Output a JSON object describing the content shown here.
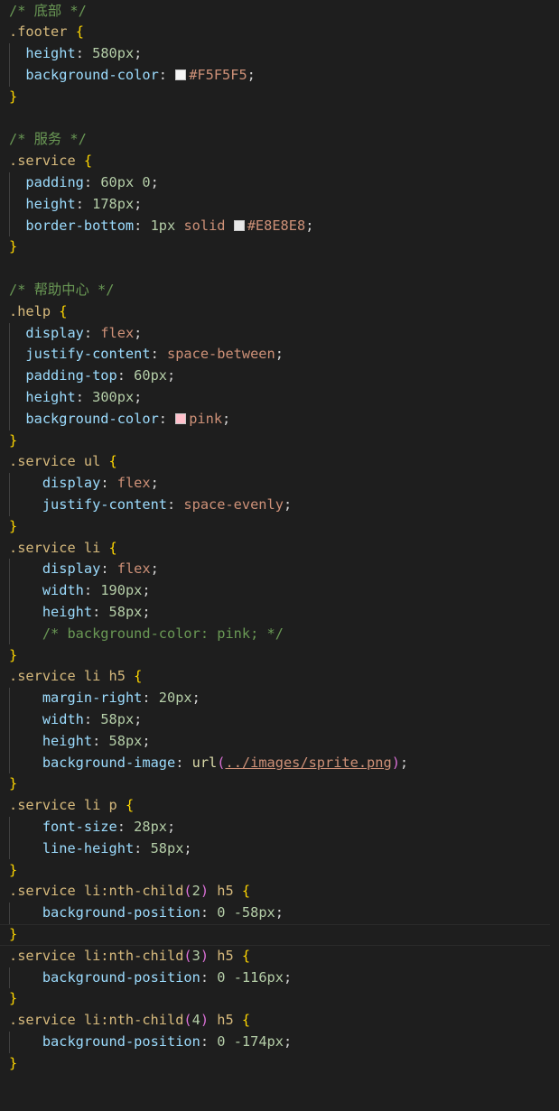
{
  "editor": {
    "language": "css",
    "theme_background": "#1e1e1e",
    "lines": [
      [
        {
          "t": "comment",
          "v": "/* 底部 */"
        }
      ],
      [
        {
          "t": "selector",
          "v": ".footer"
        },
        {
          "t": "punc",
          "v": " "
        },
        {
          "t": "brace",
          "v": "{"
        }
      ],
      [
        {
          "t": "punc",
          "v": "  "
        },
        {
          "t": "prop",
          "v": "height"
        },
        {
          "t": "punc",
          "v": ": "
        },
        {
          "t": "num",
          "v": "580px"
        },
        {
          "t": "punc",
          "v": ";"
        }
      ],
      [
        {
          "t": "punc",
          "v": "  "
        },
        {
          "t": "prop",
          "v": "background-color"
        },
        {
          "t": "punc",
          "v": ": "
        },
        {
          "t": "swatch",
          "c": "#F5F5F5"
        },
        {
          "t": "val",
          "v": "#F5F5F5"
        },
        {
          "t": "punc",
          "v": ";"
        }
      ],
      [
        {
          "t": "brace",
          "v": "}"
        }
      ],
      [],
      [
        {
          "t": "comment",
          "v": "/* 服务 */"
        }
      ],
      [
        {
          "t": "selector",
          "v": ".service"
        },
        {
          "t": "punc",
          "v": " "
        },
        {
          "t": "brace",
          "v": "{"
        }
      ],
      [
        {
          "t": "punc",
          "v": "  "
        },
        {
          "t": "prop",
          "v": "padding"
        },
        {
          "t": "punc",
          "v": ": "
        },
        {
          "t": "num",
          "v": "60px"
        },
        {
          "t": "punc",
          "v": " "
        },
        {
          "t": "num",
          "v": "0"
        },
        {
          "t": "punc",
          "v": ";"
        }
      ],
      [
        {
          "t": "punc",
          "v": "  "
        },
        {
          "t": "prop",
          "v": "height"
        },
        {
          "t": "punc",
          "v": ": "
        },
        {
          "t": "num",
          "v": "178px"
        },
        {
          "t": "punc",
          "v": ";"
        }
      ],
      [
        {
          "t": "punc",
          "v": "  "
        },
        {
          "t": "prop",
          "v": "border-bottom"
        },
        {
          "t": "punc",
          "v": ": "
        },
        {
          "t": "num",
          "v": "1px"
        },
        {
          "t": "punc",
          "v": " "
        },
        {
          "t": "val",
          "v": "solid"
        },
        {
          "t": "punc",
          "v": " "
        },
        {
          "t": "swatch",
          "c": "#E8E8E8"
        },
        {
          "t": "val",
          "v": "#E8E8E8"
        },
        {
          "t": "punc",
          "v": ";"
        }
      ],
      [
        {
          "t": "brace",
          "v": "}"
        }
      ],
      [],
      [
        {
          "t": "comment",
          "v": "/* 帮助中心 */"
        }
      ],
      [
        {
          "t": "selector",
          "v": ".help"
        },
        {
          "t": "punc",
          "v": " "
        },
        {
          "t": "brace",
          "v": "{"
        }
      ],
      [
        {
          "t": "punc",
          "v": "  "
        },
        {
          "t": "prop",
          "v": "display"
        },
        {
          "t": "punc",
          "v": ": "
        },
        {
          "t": "val",
          "v": "flex"
        },
        {
          "t": "punc",
          "v": ";"
        }
      ],
      [
        {
          "t": "punc",
          "v": "  "
        },
        {
          "t": "prop",
          "v": "justify-content"
        },
        {
          "t": "punc",
          "v": ": "
        },
        {
          "t": "val",
          "v": "space-between"
        },
        {
          "t": "punc",
          "v": ";"
        }
      ],
      [
        {
          "t": "punc",
          "v": "  "
        },
        {
          "t": "prop",
          "v": "padding-top"
        },
        {
          "t": "punc",
          "v": ": "
        },
        {
          "t": "num",
          "v": "60px"
        },
        {
          "t": "punc",
          "v": ";"
        }
      ],
      [
        {
          "t": "punc",
          "v": "  "
        },
        {
          "t": "prop",
          "v": "height"
        },
        {
          "t": "punc",
          "v": ": "
        },
        {
          "t": "num",
          "v": "300px"
        },
        {
          "t": "punc",
          "v": ";"
        }
      ],
      [
        {
          "t": "punc",
          "v": "  "
        },
        {
          "t": "prop",
          "v": "background-color"
        },
        {
          "t": "punc",
          "v": ": "
        },
        {
          "t": "swatch",
          "c": "#FFC0CB"
        },
        {
          "t": "val",
          "v": "pink"
        },
        {
          "t": "punc",
          "v": ";"
        }
      ],
      [
        {
          "t": "brace",
          "v": "}"
        }
      ],
      [
        {
          "t": "selector",
          "v": ".service ul"
        },
        {
          "t": "punc",
          "v": " "
        },
        {
          "t": "brace",
          "v": "{"
        }
      ],
      [
        {
          "t": "punc",
          "v": "    "
        },
        {
          "t": "prop",
          "v": "display"
        },
        {
          "t": "punc",
          "v": ": "
        },
        {
          "t": "val",
          "v": "flex"
        },
        {
          "t": "punc",
          "v": ";"
        }
      ],
      [
        {
          "t": "punc",
          "v": "    "
        },
        {
          "t": "prop",
          "v": "justify-content"
        },
        {
          "t": "punc",
          "v": ": "
        },
        {
          "t": "val",
          "v": "space-evenly"
        },
        {
          "t": "punc",
          "v": ";"
        }
      ],
      [
        {
          "t": "brace",
          "v": "}"
        }
      ],
      [
        {
          "t": "selector",
          "v": ".service li"
        },
        {
          "t": "punc",
          "v": " "
        },
        {
          "t": "brace",
          "v": "{"
        }
      ],
      [
        {
          "t": "punc",
          "v": "    "
        },
        {
          "t": "prop",
          "v": "display"
        },
        {
          "t": "punc",
          "v": ": "
        },
        {
          "t": "val",
          "v": "flex"
        },
        {
          "t": "punc",
          "v": ";"
        }
      ],
      [
        {
          "t": "punc",
          "v": "    "
        },
        {
          "t": "prop",
          "v": "width"
        },
        {
          "t": "punc",
          "v": ": "
        },
        {
          "t": "num",
          "v": "190px"
        },
        {
          "t": "punc",
          "v": ";"
        }
      ],
      [
        {
          "t": "punc",
          "v": "    "
        },
        {
          "t": "prop",
          "v": "height"
        },
        {
          "t": "punc",
          "v": ": "
        },
        {
          "t": "num",
          "v": "58px"
        },
        {
          "t": "punc",
          "v": ";"
        }
      ],
      [
        {
          "t": "punc",
          "v": "    "
        },
        {
          "t": "comment",
          "v": "/* background-color: pink; */"
        }
      ],
      [
        {
          "t": "brace",
          "v": "}"
        }
      ],
      [
        {
          "t": "selector",
          "v": ".service li h5"
        },
        {
          "t": "punc",
          "v": " "
        },
        {
          "t": "brace",
          "v": "{"
        }
      ],
      [
        {
          "t": "punc",
          "v": "    "
        },
        {
          "t": "prop",
          "v": "margin-right"
        },
        {
          "t": "punc",
          "v": ": "
        },
        {
          "t": "num",
          "v": "20px"
        },
        {
          "t": "punc",
          "v": ";"
        }
      ],
      [
        {
          "t": "punc",
          "v": "    "
        },
        {
          "t": "prop",
          "v": "width"
        },
        {
          "t": "punc",
          "v": ": "
        },
        {
          "t": "num",
          "v": "58px"
        },
        {
          "t": "punc",
          "v": ";"
        }
      ],
      [
        {
          "t": "punc",
          "v": "    "
        },
        {
          "t": "prop",
          "v": "height"
        },
        {
          "t": "punc",
          "v": ": "
        },
        {
          "t": "num",
          "v": "58px"
        },
        {
          "t": "punc",
          "v": ";"
        }
      ],
      [
        {
          "t": "punc",
          "v": "    "
        },
        {
          "t": "prop",
          "v": "background-image"
        },
        {
          "t": "punc",
          "v": ": "
        },
        {
          "t": "func",
          "v": "url"
        },
        {
          "t": "paren",
          "v": "("
        },
        {
          "t": "link",
          "v": "../images/sprite.png"
        },
        {
          "t": "paren",
          "v": ")"
        },
        {
          "t": "punc",
          "v": ";"
        }
      ],
      [
        {
          "t": "brace",
          "v": "}"
        }
      ],
      [
        {
          "t": "selector",
          "v": ".service li p"
        },
        {
          "t": "punc",
          "v": " "
        },
        {
          "t": "brace",
          "v": "{"
        }
      ],
      [
        {
          "t": "punc",
          "v": "    "
        },
        {
          "t": "prop",
          "v": "font-size"
        },
        {
          "t": "punc",
          "v": ": "
        },
        {
          "t": "num",
          "v": "28px"
        },
        {
          "t": "punc",
          "v": ";"
        }
      ],
      [
        {
          "t": "punc",
          "v": "    "
        },
        {
          "t": "prop",
          "v": "line-height"
        },
        {
          "t": "punc",
          "v": ": "
        },
        {
          "t": "num",
          "v": "58px"
        },
        {
          "t": "punc",
          "v": ";"
        }
      ],
      [
        {
          "t": "brace",
          "v": "}"
        }
      ],
      [
        {
          "t": "selector",
          "v": ".service li:nth-child"
        },
        {
          "t": "paren",
          "v": "("
        },
        {
          "t": "num",
          "v": "2"
        },
        {
          "t": "paren",
          "v": ")"
        },
        {
          "t": "selector",
          "v": " h5"
        },
        {
          "t": "punc",
          "v": " "
        },
        {
          "t": "brace",
          "v": "{"
        }
      ],
      [
        {
          "t": "punc",
          "v": "    "
        },
        {
          "t": "prop",
          "v": "background-position"
        },
        {
          "t": "punc",
          "v": ": "
        },
        {
          "t": "num",
          "v": "0"
        },
        {
          "t": "punc",
          "v": " "
        },
        {
          "t": "num",
          "v": "-58px"
        },
        {
          "t": "punc",
          "v": ";"
        }
      ],
      [
        {
          "t": "brace",
          "v": "}"
        }
      ],
      [
        {
          "t": "selector",
          "v": ".service li:nth-child"
        },
        {
          "t": "paren",
          "v": "("
        },
        {
          "t": "num",
          "v": "3"
        },
        {
          "t": "paren",
          "v": ")"
        },
        {
          "t": "selector",
          "v": " h5"
        },
        {
          "t": "punc",
          "v": " "
        },
        {
          "t": "brace",
          "v": "{"
        }
      ],
      [
        {
          "t": "punc",
          "v": "    "
        },
        {
          "t": "prop",
          "v": "background-position"
        },
        {
          "t": "punc",
          "v": ": "
        },
        {
          "t": "num",
          "v": "0"
        },
        {
          "t": "punc",
          "v": " "
        },
        {
          "t": "num",
          "v": "-116px"
        },
        {
          "t": "punc",
          "v": ";"
        }
      ],
      [
        {
          "t": "brace",
          "v": "}"
        }
      ],
      [
        {
          "t": "selector",
          "v": ".service li:nth-child"
        },
        {
          "t": "paren",
          "v": "("
        },
        {
          "t": "num",
          "v": "4"
        },
        {
          "t": "paren",
          "v": ")"
        },
        {
          "t": "selector",
          "v": " h5"
        },
        {
          "t": "punc",
          "v": " "
        },
        {
          "t": "brace",
          "v": "{"
        }
      ],
      [
        {
          "t": "punc",
          "v": "    "
        },
        {
          "t": "prop",
          "v": "background-position"
        },
        {
          "t": "punc",
          "v": ": "
        },
        {
          "t": "num",
          "v": "0"
        },
        {
          "t": "punc",
          "v": " "
        },
        {
          "t": "num",
          "v": "-174px"
        },
        {
          "t": "punc",
          "v": ";"
        }
      ],
      [
        {
          "t": "brace",
          "v": "}"
        }
      ]
    ],
    "current_line": 43
  }
}
